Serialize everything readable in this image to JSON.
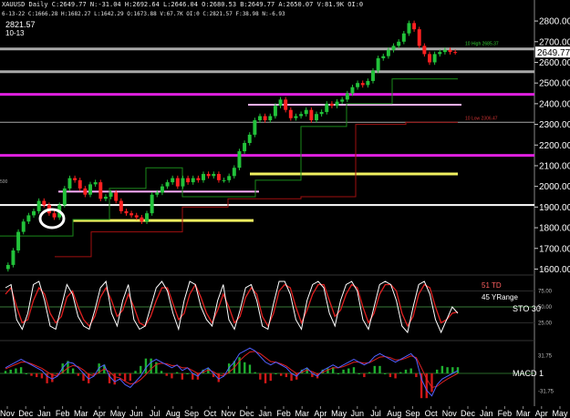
{
  "header": {
    "line1": "XAUUSD Daily  C:2649.77  N:-31.04  H:2692.64  L:2646.04  O:2680.53  B:2649.77  A:2650.07  V:81.9K  OI:0",
    "line2": "6-13-22  C:1666.28  H:1682.27  L:1642.29  O:1673.88  V:67.7K  OI:0  C:2821.57  F:38.98  N:-6.93",
    "ref_value": "2821.57",
    "ref_date": "10-13",
    "left_tick": "500"
  },
  "indicator_labels": {
    "td": "51 TD",
    "yrange": "45 YRange",
    "sto": "STO  30",
    "macd": "MACD 1"
  },
  "colors": {
    "bg": "#000000",
    "up": "#22c23a",
    "down": "#ff2020",
    "magenta": "#e020e0",
    "pink": "#ffb0ff",
    "yellow": "#f0f060",
    "white": "#ffffff",
    "gray": "#a8a8a8",
    "stoch_k": "#ffffff",
    "stoch_d": "#e02020",
    "macd_line": "#5060ff",
    "signal_line": "#e02020"
  },
  "chart_data": [
    {
      "type": "line",
      "series": [
        {
          "values": [
            1620,
            1690,
            1780,
            1830,
            1860,
            1880,
            1930,
            1910,
            1870,
            1850,
            1910,
            1990,
            2040,
            2030,
            1990,
            1960,
            2010,
            2020,
            1940,
            1950,
            1970,
            1930,
            1880,
            1870,
            1860,
            1850,
            1830,
            1870,
            1960,
            1970,
            2000,
            2020,
            2040,
            2000,
            2040,
            2020,
            2040,
            2030,
            2060,
            2050,
            2060,
            2030,
            2030,
            2050,
            2090,
            2170,
            2210,
            2250,
            2320,
            2340,
            2320,
            2340,
            2390,
            2420,
            2370,
            2330,
            2340,
            2350,
            2370,
            2320,
            2350,
            2360,
            2400,
            2390,
            2410,
            2420,
            2450,
            2480,
            2500,
            2490,
            2510,
            2560,
            2620,
            2630,
            2660,
            2680,
            2700,
            2740,
            2790,
            2760,
            2680,
            2640,
            2600,
            2640,
            2650,
            2660,
            2650,
            2649.77
          ]
        }
      ],
      "price_label": "2649.77",
      "high_label": "10 High 2685.37",
      "low_label": "10 Low 2306.47",
      "y_ticks": [
        1600,
        1700,
        1800,
        1900,
        2000,
        2100,
        2200,
        2300,
        2400,
        2500,
        2600,
        2700,
        2800
      ],
      "ylim": [
        1580,
        2840
      ],
      "x_tick_labels": [
        "Nov",
        "Dec",
        "Jan",
        "Feb",
        "Mar",
        "Apr",
        "May",
        "Jun",
        "Jul",
        "Aug",
        "Sep",
        "Oct",
        "Nov",
        "Dec",
        "Jan",
        "Feb",
        "Mar",
        "Apr",
        "May",
        "Jun",
        "Jul",
        "Aug",
        "Sep",
        "Oct",
        "Nov",
        "Dec",
        "Jan",
        "Feb",
        "Mar",
        "Apr",
        "May"
      ],
      "horizontal_levels": [
        {
          "value": 2665,
          "color": "gray"
        },
        {
          "value": 2555,
          "color": "gray"
        },
        {
          "value": 2445,
          "color": "magenta"
        },
        {
          "value": 2395,
          "color": "pink"
        },
        {
          "value": 2310,
          "color": "gray"
        },
        {
          "value": 2150,
          "color": "magenta"
        },
        {
          "value": 2060,
          "color": "yellow"
        },
        {
          "value": 1975,
          "color": "pink"
        },
        {
          "value": 1910,
          "color": "white"
        },
        {
          "value": 1835,
          "color": "yellow"
        }
      ]
    },
    {
      "type": "line",
      "y_ticks": [
        75,
        50,
        25
      ],
      "ylim": [
        0,
        100
      ],
      "series": [
        {
          "values": [
            80,
            85,
            30,
            15,
            40,
            85,
            90,
            60,
            20,
            15,
            50,
            85,
            70,
            35,
            20,
            15,
            45,
            80,
            90,
            40,
            20,
            60,
            85,
            30,
            15,
            20,
            50,
            80,
            90,
            75,
            40,
            15,
            60,
            90,
            85,
            50,
            30,
            20,
            60,
            85,
            30,
            15,
            45,
            80,
            85,
            60,
            20,
            15,
            55,
            90,
            90,
            70,
            30,
            15,
            60,
            85,
            90,
            80,
            40,
            20,
            60,
            85,
            90,
            75,
            30,
            15,
            50,
            85,
            90,
            85,
            60,
            20,
            10,
            50,
            85,
            90,
            70,
            30,
            10,
            30,
            50,
            40
          ]
        },
        {
          "values": [
            70,
            80,
            50,
            25,
            30,
            60,
            80,
            70,
            40,
            25,
            35,
            65,
            75,
            50,
            30,
            20,
            35,
            65,
            80,
            60,
            35,
            45,
            70,
            50,
            25,
            20,
            35,
            60,
            80,
            80,
            55,
            30,
            40,
            70,
            85,
            65,
            40,
            25,
            45,
            70,
            50,
            25,
            35,
            65,
            80,
            70,
            35,
            20,
            40,
            75,
            85,
            80,
            50,
            25,
            45,
            70,
            85,
            85,
            60,
            35,
            45,
            70,
            85,
            80,
            50,
            25,
            40,
            70,
            85,
            85,
            75,
            40,
            20,
            35,
            70,
            85,
            80,
            50,
            25,
            30,
            40,
            42
          ]
        }
      ]
    },
    {
      "type": "bar",
      "y_ticks": [
        31.75,
        -31.75
      ],
      "ylim": [
        -55,
        55
      ],
      "series": [
        {
          "values": [
            10,
            15,
            20,
            25,
            20,
            15,
            10,
            5,
            -5,
            -10,
            -5,
            10,
            20,
            18,
            10,
            0,
            -10,
            -5,
            10,
            15,
            -5,
            -15,
            -10,
            -20,
            -25,
            -15,
            -5,
            10,
            20,
            25,
            20,
            15,
            10,
            15,
            5,
            10,
            0,
            -5,
            5,
            10,
            0,
            -10,
            -5,
            10,
            20,
            35,
            40,
            45,
            40,
            30,
            20,
            15,
            20,
            15,
            10,
            0,
            -5,
            5,
            10,
            0,
            -5,
            5,
            10,
            15,
            10,
            15,
            20,
            25,
            20,
            15,
            20,
            30,
            35,
            30,
            25,
            20,
            25,
            30,
            35,
            25,
            -10,
            -30,
            -40,
            -20,
            -10,
            -5,
            0,
            5
          ]
        },
        {
          "values": [
            8,
            12,
            16,
            20,
            20,
            17,
            13,
            9,
            3,
            -3,
            -4,
            2,
            10,
            14,
            12,
            6,
            -2,
            -4,
            2,
            8,
            3,
            -6,
            -8,
            -14,
            -19,
            -17,
            -11,
            -2,
            8,
            16,
            18,
            17,
            14,
            14,
            10,
            10,
            5,
            0,
            2,
            6,
            3,
            -3,
            -4,
            2,
            10,
            22,
            31,
            38,
            39,
            35,
            28,
            21,
            20,
            17,
            13,
            6,
            0,
            2,
            6,
            3,
            -1,
            2,
            6,
            10,
            10,
            12,
            16,
            20,
            20,
            18,
            19,
            24,
            29,
            30,
            28,
            24,
            24,
            27,
            31,
            28,
            10,
            -10,
            -25,
            -23,
            -16,
            -10,
            -5,
            0
          ]
        }
      ]
    }
  ]
}
